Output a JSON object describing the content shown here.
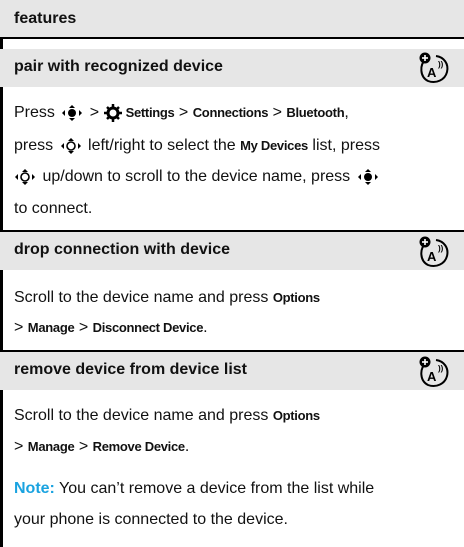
{
  "header": {
    "title": "features"
  },
  "sections": [
    {
      "title": "pair with recognized device",
      "icon": "network-feature-icon",
      "line1": {
        "press": "Press",
        "settings": "Settings",
        "connections": "Connections",
        "bluetooth": "Bluetooth"
      },
      "line2": {
        "press": "press",
        "text_a": "left/right to select the",
        "my_devices": "My Devices",
        "text_b": "list, press"
      },
      "line3": {
        "text": "up/down to scroll to the device name, press"
      },
      "line4": {
        "text": "to connect."
      }
    },
    {
      "title": "drop connection with device",
      "icon": "network-feature-icon",
      "line1": {
        "text": "Scroll to the device name and press",
        "options": "Options"
      },
      "line2": {
        "manage": "Manage",
        "action": "Disconnect Device"
      }
    },
    {
      "title": "remove device from device list",
      "icon": "network-feature-icon",
      "line1": {
        "text": "Scroll to the device name and press",
        "options": "Options"
      },
      "line2": {
        "manage": "Manage",
        "action": "Remove Device"
      }
    }
  ],
  "note": {
    "label": "Note:",
    "line1": "You can’t remove a device from the list while",
    "line2": "your phone is connected to the device."
  },
  "colors": {
    "header_bg": "#e6e6e6",
    "note_accent": "#1aa3e0"
  }
}
